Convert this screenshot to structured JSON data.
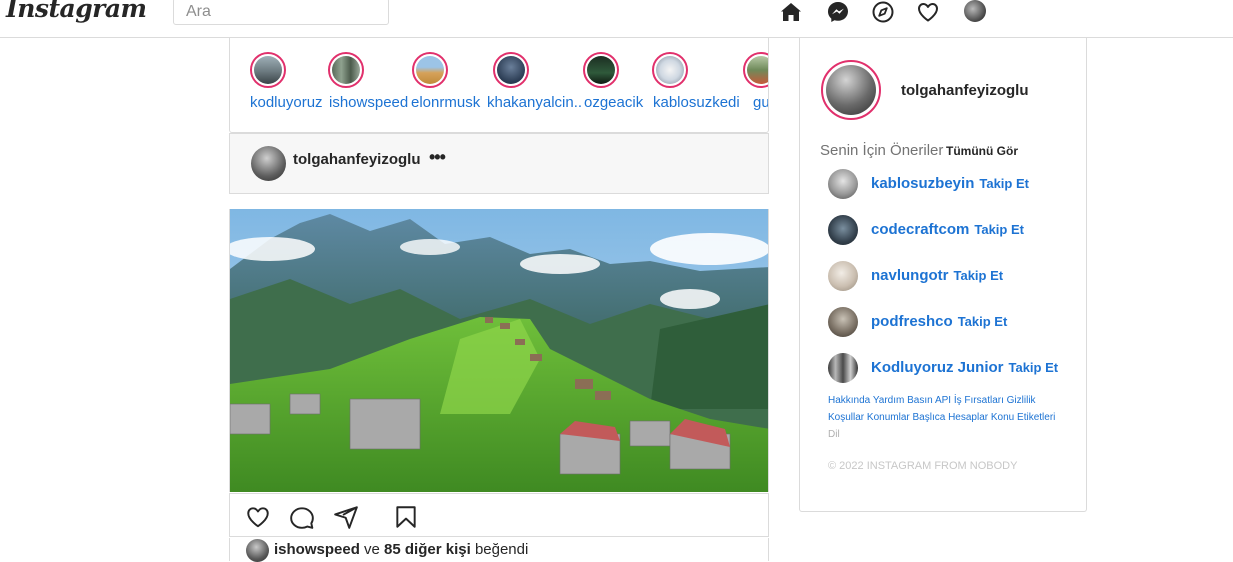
{
  "app": {
    "logo_text": "Instagram"
  },
  "search": {
    "placeholder": "Ara"
  },
  "nav": {
    "icons": [
      "home-icon",
      "messenger-icon",
      "explore-icon",
      "heart-icon",
      "profile-avatar"
    ]
  },
  "stories": [
    {
      "username": "kodluyoruz"
    },
    {
      "username": "ishowspeed"
    },
    {
      "username": "elonrmusk"
    },
    {
      "username": "khakanyalcin.."
    },
    {
      "username": "ozgeacik"
    },
    {
      "username": "kablosuzkedi"
    },
    {
      "username": "gulcany"
    }
  ],
  "post": {
    "username": "tolgahanfeyizoglu",
    "more_label": "•••",
    "image_alt": "Mountain plateau with wooden houses",
    "actions": [
      "heart-icon",
      "comment-icon",
      "share-icon",
      "bookmark-icon"
    ],
    "likes": {
      "first_user": "ishowspeed",
      "connector": "ve",
      "others": "85 diğer kişi",
      "suffix": "beğendi"
    }
  },
  "sidebar": {
    "current_user": "tolgahanfeyizoglu",
    "suggestions_title": "Senin İçin Öneriler",
    "see_all": "Tümünü Gör",
    "follow_label": "Takip Et",
    "suggestions": [
      {
        "username": "kablosuzbeyin"
      },
      {
        "username": "codecraftcom"
      },
      {
        "username": "navlungotr"
      },
      {
        "username": "podfreshco"
      },
      {
        "username": "Kodluyoruz Junior"
      }
    ],
    "footer_links": [
      "Hakkında",
      "Yardım",
      "Basın",
      "API",
      "İş Fırsatları",
      "Gizlilik",
      "Koşullar",
      "Konumlar",
      "Başlıca Hesaplar",
      "Konu Etiketleri"
    ],
    "footer_dim": "Dil",
    "copyright": "© 2022 INSTAGRAM FROM NOBODY"
  },
  "colors": {
    "link": "#1d73d3",
    "story_ring": "#e1306c",
    "border": "#dbdbdb"
  }
}
